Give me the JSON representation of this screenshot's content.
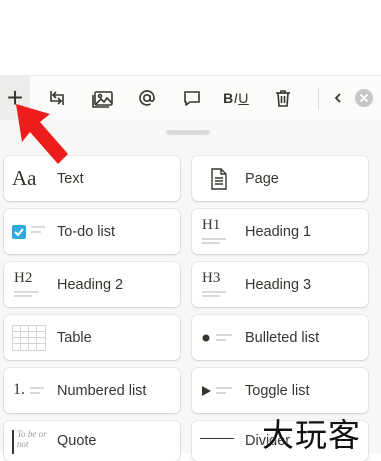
{
  "toolbar": {
    "items": [
      {
        "name": "add-block",
        "icon": "plus-icon",
        "glyph": "+"
      },
      {
        "name": "turn-into",
        "icon": "turn-into-icon"
      },
      {
        "name": "insert-image",
        "icon": "image-icon"
      },
      {
        "name": "mention",
        "icon": "at-icon"
      },
      {
        "name": "comment",
        "icon": "comment-icon"
      },
      {
        "name": "text-format",
        "icon": "text-format-icon",
        "b": "B",
        "i": "I",
        "u": "U"
      },
      {
        "name": "delete",
        "icon": "trash-icon"
      },
      {
        "name": "collapse",
        "icon": "chevron-left-icon"
      },
      {
        "name": "close",
        "icon": "close-icon"
      }
    ]
  },
  "blocks": [
    {
      "label": "Text",
      "icon": "text-icon",
      "icon_text": "Aa"
    },
    {
      "label": "Page",
      "icon": "page-icon"
    },
    {
      "label": "To-do list",
      "icon": "checkbox-icon"
    },
    {
      "label": "Heading 1",
      "icon": "heading1-icon",
      "icon_text": "H1"
    },
    {
      "label": "Heading 2",
      "icon": "heading2-icon",
      "icon_text": "H2"
    },
    {
      "label": "Heading 3",
      "icon": "heading3-icon",
      "icon_text": "H3"
    },
    {
      "label": "Table",
      "icon": "table-icon"
    },
    {
      "label": "Bulleted list",
      "icon": "bullet-icon"
    },
    {
      "label": "Numbered list",
      "icon": "numbered-icon",
      "icon_text": "1."
    },
    {
      "label": "Toggle list",
      "icon": "toggle-icon"
    },
    {
      "label": "Quote",
      "icon": "quote-icon",
      "icon_text": "To be or not"
    },
    {
      "label": "Divider",
      "icon": "divider-icon"
    }
  ],
  "watermark": "大玩客",
  "colors": {
    "accent": "#2eaadc",
    "arrow": "#ee1d1d",
    "toolbar_bg": "#fbfbfa",
    "sheet_bg": "#f7f7f5"
  }
}
